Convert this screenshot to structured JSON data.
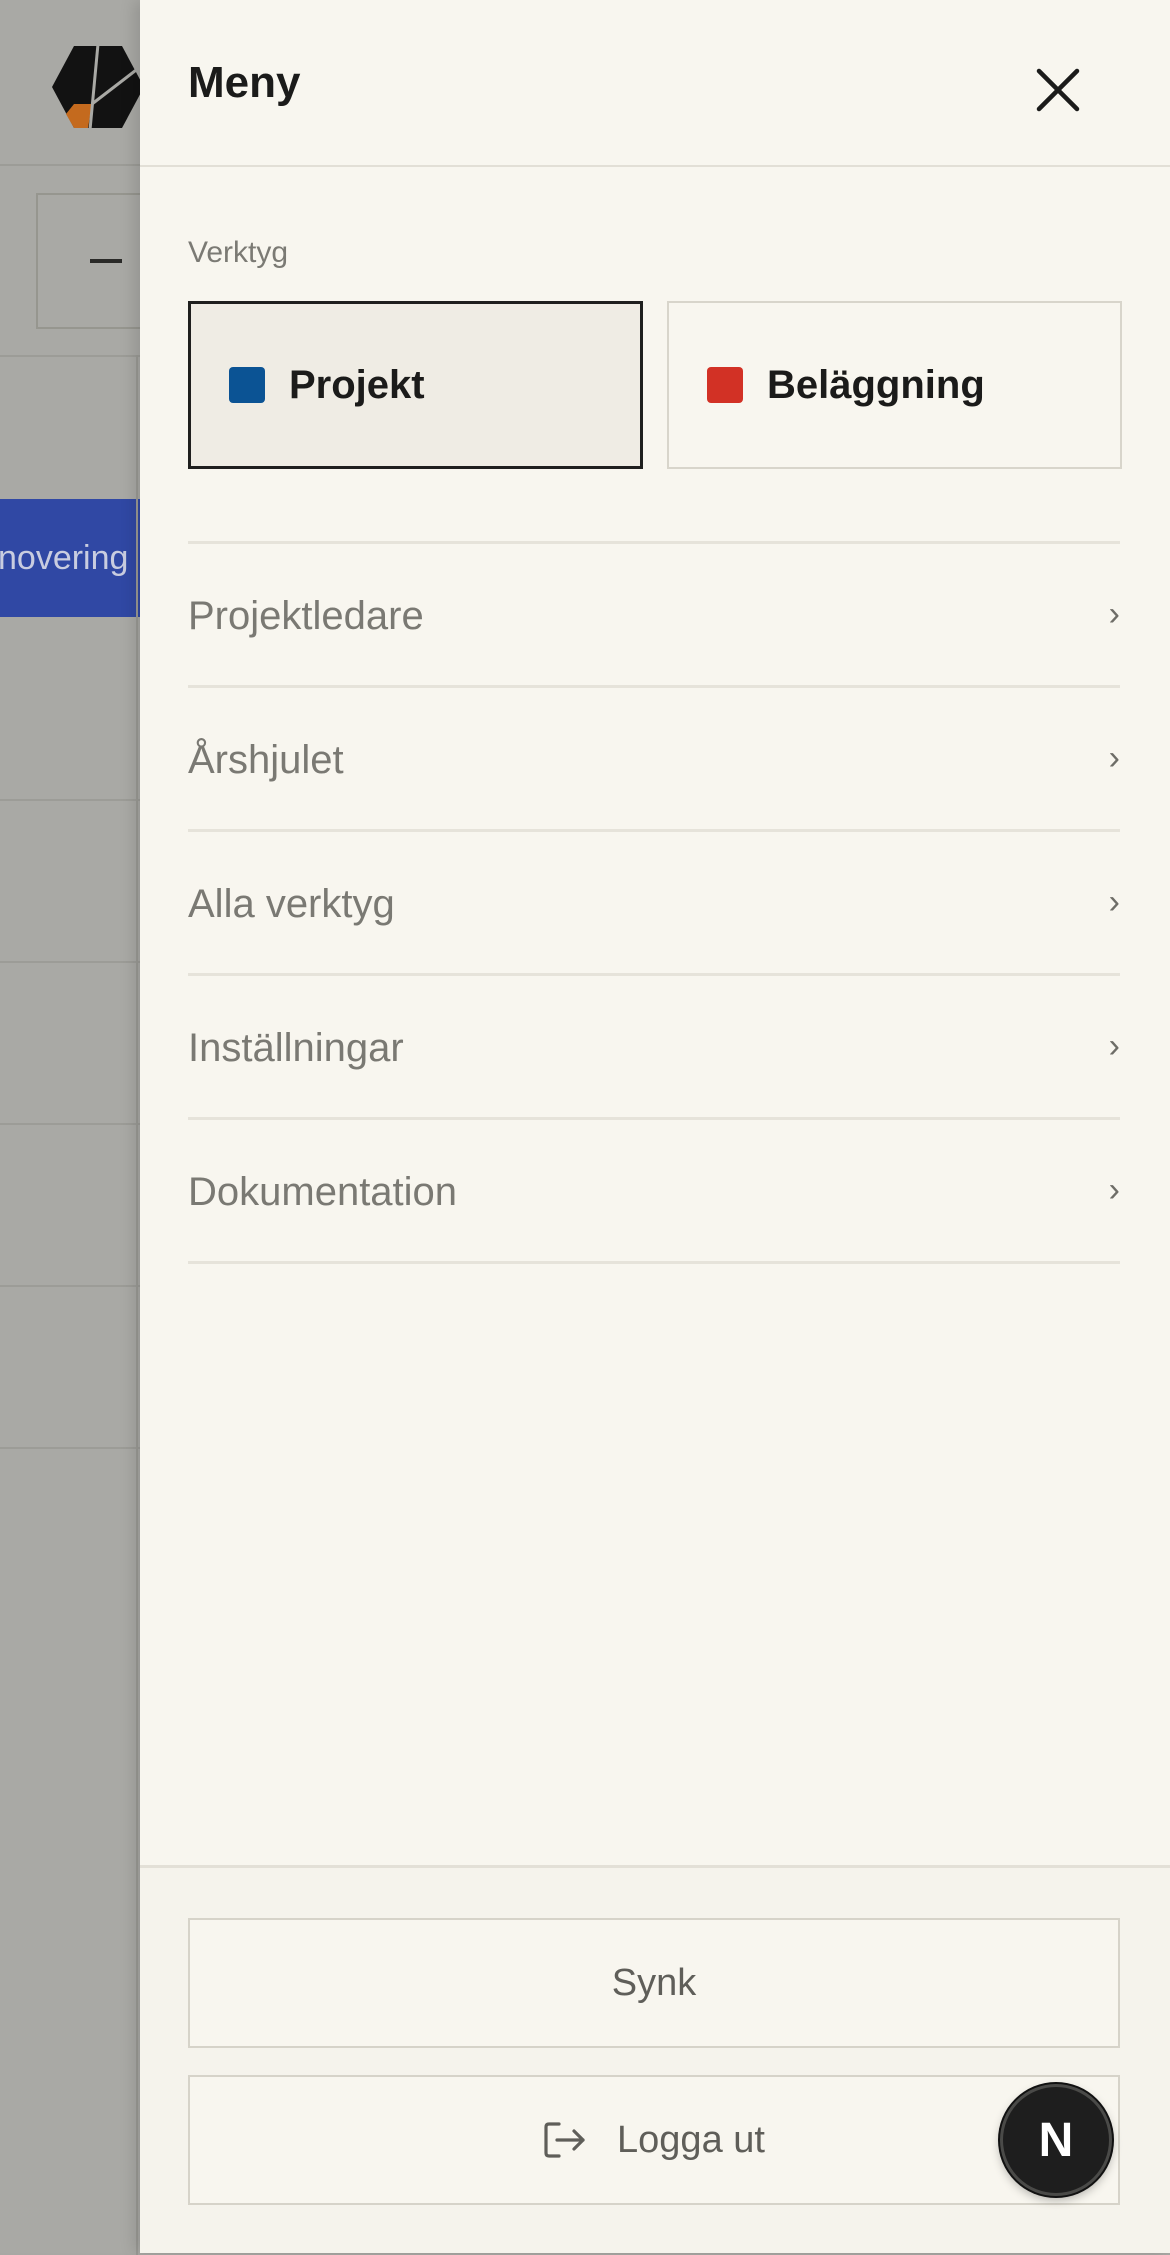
{
  "background": {
    "blue_button_label": "novering"
  },
  "drawer": {
    "title": "Meny",
    "close_icon": "close-icon",
    "tools_label": "Verktyg",
    "tools": [
      {
        "label": "Projekt",
        "color": "#0b5394",
        "active": true
      },
      {
        "label": "Beläggning",
        "color": "#d23125",
        "active": false
      }
    ],
    "nav_items": [
      {
        "label": "Projektledare",
        "chevron": "›"
      },
      {
        "label": "Årshjulet",
        "chevron": "›"
      },
      {
        "label": "Alla verktyg",
        "chevron": "›"
      },
      {
        "label": "Inställningar",
        "chevron": "›"
      },
      {
        "label": "Dokumentation",
        "chevron": "›"
      }
    ],
    "footer": {
      "sync_label": "Synk",
      "logout_label": "Logga ut",
      "logout_icon": "logout-icon"
    }
  },
  "badge": {
    "letter": "N"
  }
}
